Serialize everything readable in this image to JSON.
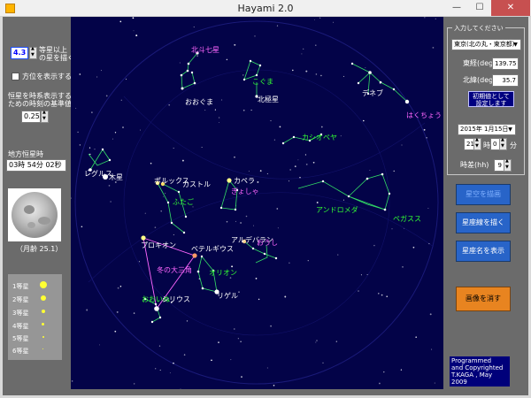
{
  "window": {
    "title": "Hayami 2.0",
    "min": "—",
    "max": "☐",
    "close": "✕"
  },
  "left": {
    "magnitude_value": "4.3",
    "magnitude_label_1": "等星以上",
    "magnitude_label_2": "の星を描く",
    "direction_label": "方位を表示する",
    "interval_label_1": "恒星を時系表示する",
    "interval_label_2": "ための時刻の基準値",
    "interval_value": "0.25",
    "sidereal_label": "地方恒星時",
    "sidereal_value": "03時 54分 02秒",
    "moon_age": "（月齢 25.1）",
    "legend": [
      "1等星",
      "2等星",
      "3等星",
      "4等星",
      "5等星",
      "6等星"
    ]
  },
  "sky": {
    "labels": {
      "hokuto": "北斗七星",
      "ookuma": "おおぐま",
      "kogoma": "こぐま",
      "hokkyoku": "北極星",
      "deneb": "デネブ",
      "hakucho": "はくちょう",
      "cassiopeia": "カシオペヤ",
      "regulus": "レグルス",
      "jupiter": "木星",
      "pollux": "ポルックス",
      "castor": "カストル",
      "capella": "カペラ",
      "gyosha": "ぎょしゃ",
      "futago": "ふたご",
      "andromeda": "アンドロメダ",
      "pegasus": "ペガスス",
      "aldebaran": "アルデバラン",
      "oushi": "おうし",
      "procyon": "プロキオン",
      "betelgeuse": "ベテルギウス",
      "triangle": "冬の大三角",
      "orion": "オリオン",
      "rigel": "リゲル",
      "ooinu": "おおいぬ",
      "sirius": "シリウス"
    }
  },
  "right": {
    "group_title": "入力してください",
    "location": "東京(北の丸・東京都)",
    "longitude_label": "東経(deg)",
    "longitude_value": "139.75",
    "latitude_label": "北緯(deg)",
    "latitude_value": "35.7",
    "set_initial_1": "初期値として",
    "set_initial_2": "設定します",
    "date": "2015年 1月15日",
    "hour": "21",
    "hour_unit": "時",
    "minute": "0",
    "minute_unit": "分",
    "timediff_label": "時差(hh)",
    "timediff_value": "9",
    "btn_draw_sky": "星空を描画",
    "btn_draw_lines": "星座線を描く",
    "btn_show_names": "星座名を表示",
    "btn_clear": "画像を消す",
    "credits": [
      "Programmed",
      "and Copyrighted",
      "T.KAGA , May",
      "2009"
    ]
  }
}
